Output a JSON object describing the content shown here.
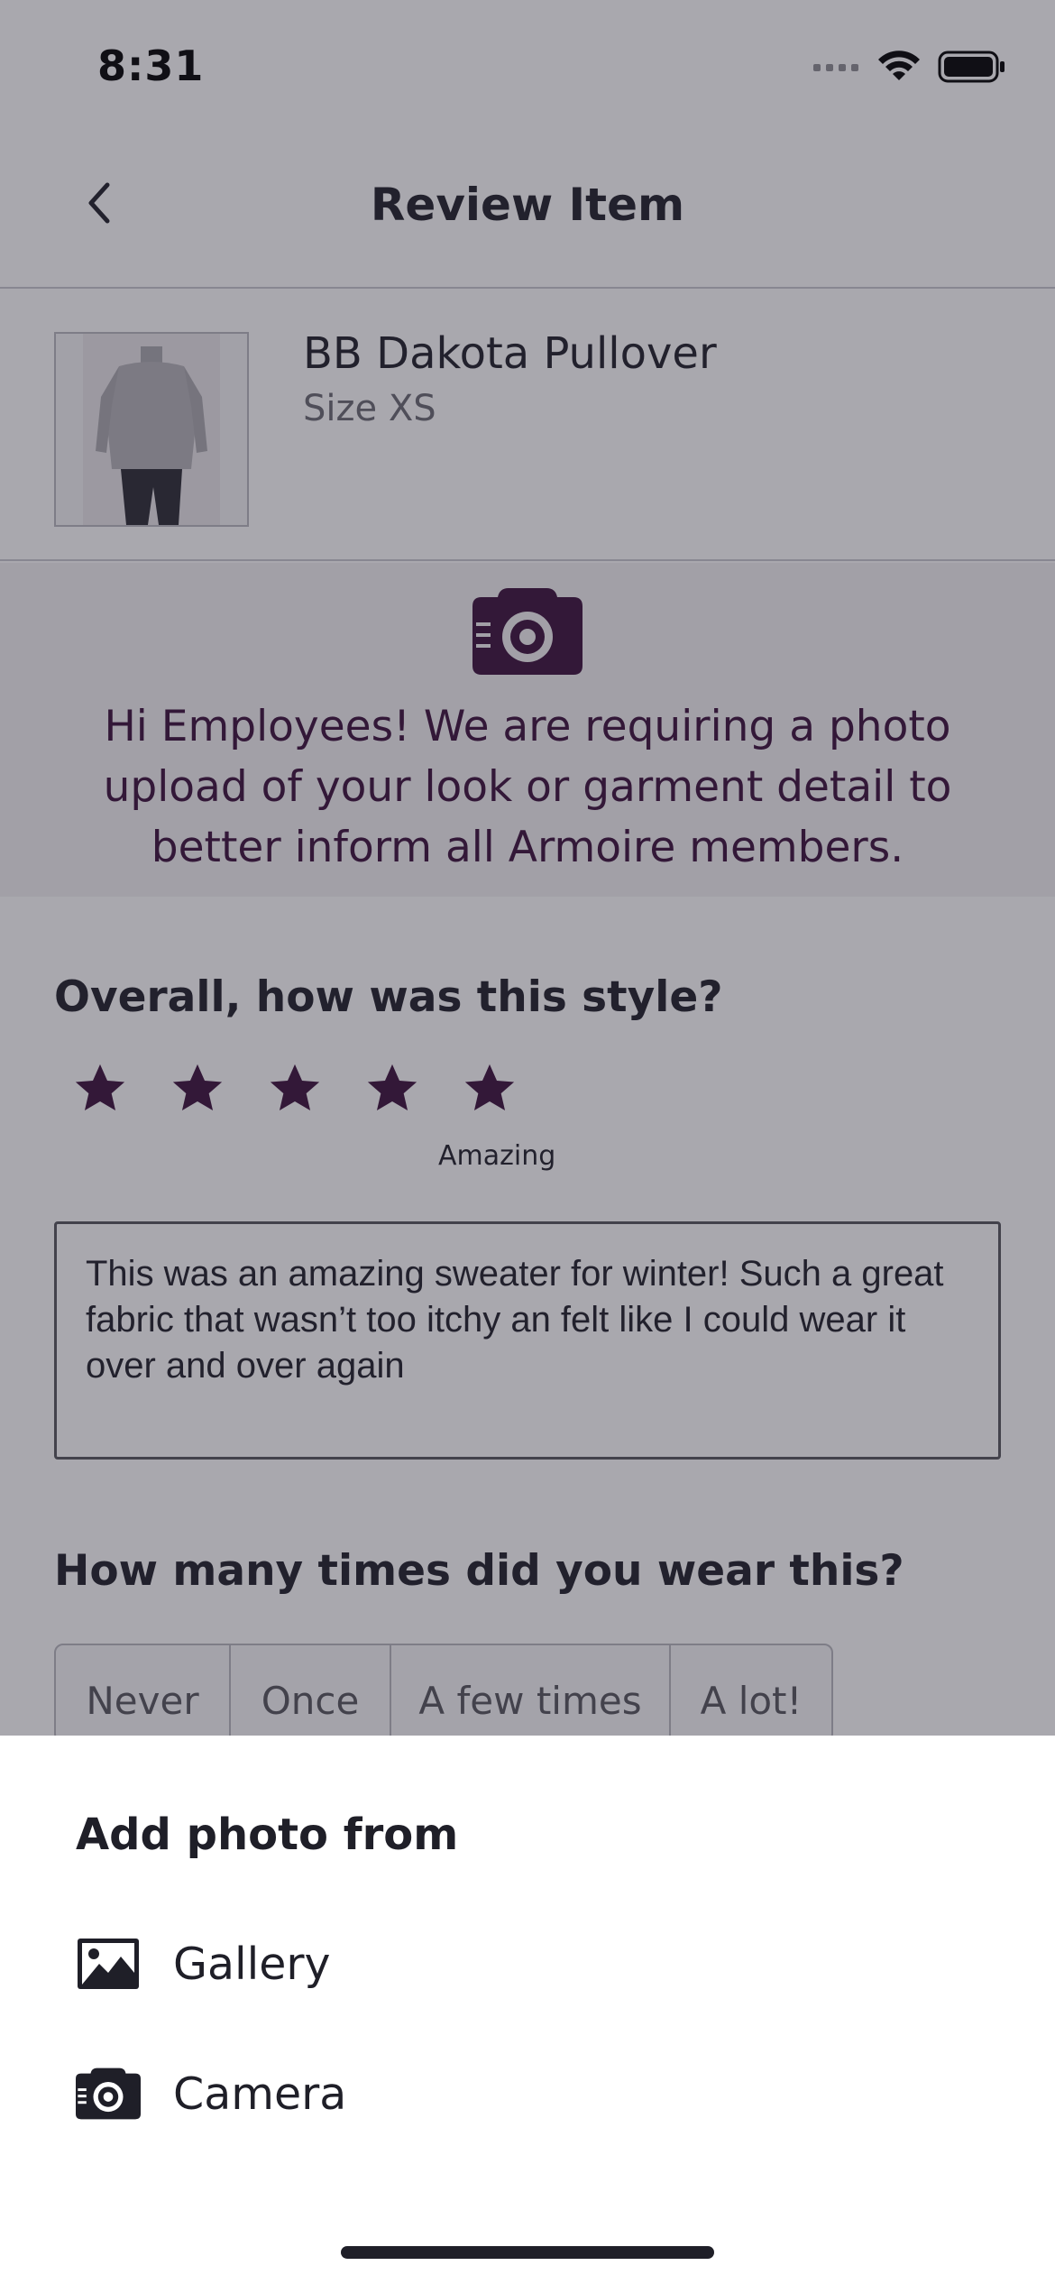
{
  "status_bar": {
    "time": "8:31"
  },
  "nav": {
    "title": "Review Item"
  },
  "product": {
    "name": "BB Dakota Pullover",
    "size": "Size XS"
  },
  "notice": {
    "text": "Hi Employees! We are requiring a photo upload of your look or garment detail to better inform all Armoire members."
  },
  "rating": {
    "question": "Overall, how was this style?",
    "stars_filled": 5,
    "stars_total": 5,
    "label": "Amazing"
  },
  "review": {
    "text": "This was an amazing sweater for winter! Such a great fabric that wasn’t too itchy an felt like I could wear it over and over again"
  },
  "wear": {
    "question": "How many times did you wear this?",
    "options": [
      "Never",
      "Once",
      "A few times",
      "A lot!"
    ]
  },
  "sheet": {
    "title": "Add photo from",
    "options": [
      {
        "label": "Gallery",
        "icon": "image-icon"
      },
      {
        "label": "Camera",
        "icon": "camera-icon"
      }
    ]
  },
  "colors": {
    "accent": "#3b0f3b",
    "text": "#1f1f28",
    "muted": "#6a6a72"
  }
}
